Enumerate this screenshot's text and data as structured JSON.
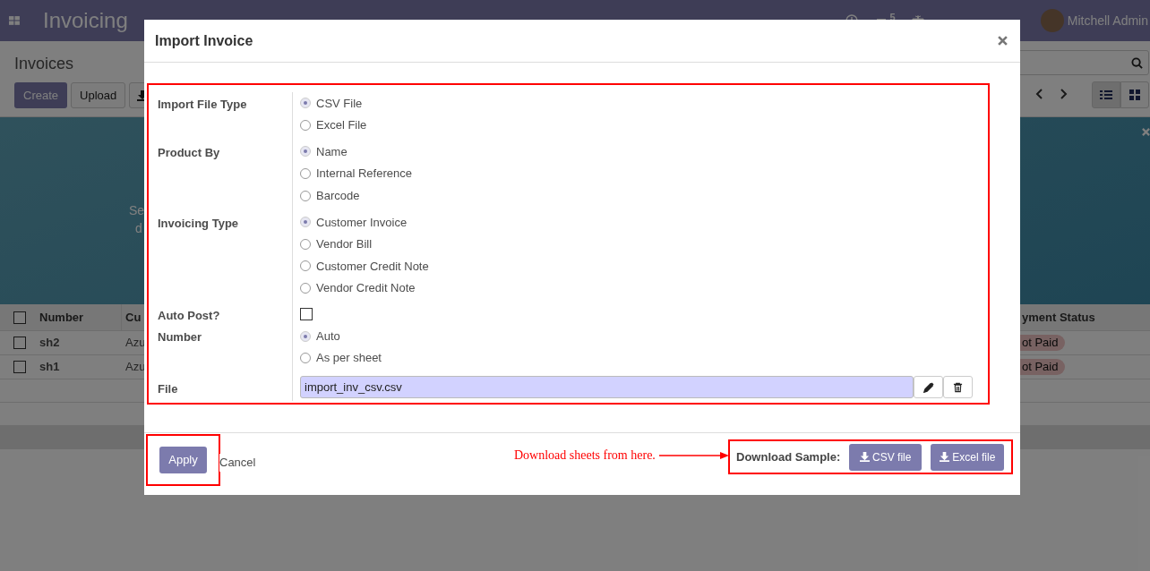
{
  "navbar": {
    "app_name": "Invoicing",
    "chat_count": "5",
    "user": "Mitchell Admin"
  },
  "control_panel": {
    "breadcrumb": "Invoices",
    "buttons": [
      "Create",
      "Upload"
    ]
  },
  "banner": {
    "texts": [
      "Se",
      "d"
    ]
  },
  "list": {
    "columns": [
      "Number",
      "Cu",
      "yment Status"
    ],
    "header_checked": false,
    "rows": [
      {
        "number": "sh2",
        "customer": "Azu",
        "status": "ot Paid",
        "checked": false
      },
      {
        "number": "sh1",
        "customer": "Azu",
        "status": "ot Paid",
        "checked": false
      }
    ]
  },
  "dialog": {
    "title": "Import Invoice",
    "fields": [
      {
        "label": "Import File Type",
        "kind": "radio",
        "options": [
          {
            "label": "CSV File",
            "selected": true
          },
          {
            "label": "Excel File",
            "selected": false
          }
        ]
      },
      {
        "label": "Product By",
        "kind": "radio",
        "options": [
          {
            "label": "Name",
            "selected": true
          },
          {
            "label": "Internal Reference",
            "selected": false
          },
          {
            "label": "Barcode",
            "selected": false
          }
        ]
      },
      {
        "label": "Invoicing Type",
        "kind": "radio",
        "options": [
          {
            "label": "Customer Invoice",
            "selected": true
          },
          {
            "label": "Vendor Bill",
            "selected": false
          },
          {
            "label": "Customer Credit Note",
            "selected": false
          },
          {
            "label": "Vendor Credit Note",
            "selected": false
          }
        ]
      },
      {
        "label": "Auto Post?",
        "kind": "checkbox",
        "checked": false
      },
      {
        "label": "Number",
        "kind": "radio",
        "options": [
          {
            "label": "Auto",
            "selected": true
          },
          {
            "label": "As per sheet",
            "selected": false
          }
        ]
      },
      {
        "label": "File",
        "kind": "file",
        "value": "import_inv_csv.csv"
      }
    ],
    "footer": {
      "primary": "Apply",
      "secondary": "Cancel",
      "annotation": "Download sheets from here.",
      "download_label": "Download Sample:",
      "download_buttons": [
        "CSV file",
        "Excel file"
      ]
    }
  }
}
